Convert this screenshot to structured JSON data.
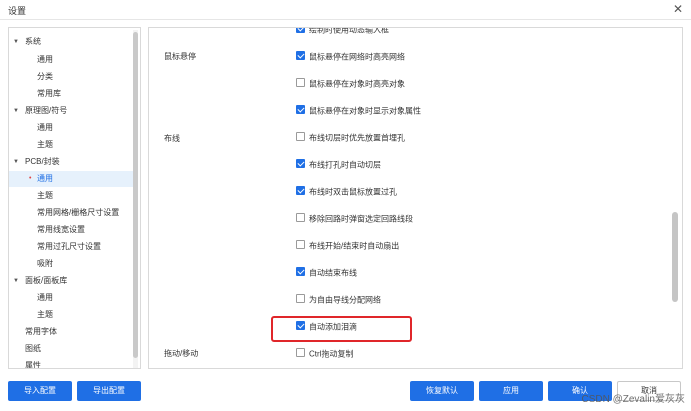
{
  "window": {
    "title": "设置",
    "close_glyph": "✕"
  },
  "tree": [
    {
      "label": "系统",
      "expanded": true,
      "level": 0
    },
    {
      "label": "通用",
      "level": 1
    },
    {
      "label": "分类",
      "level": 1
    },
    {
      "label": "常用库",
      "level": 1
    },
    {
      "label": "原理图/符号",
      "expanded": true,
      "level": 0
    },
    {
      "label": "通用",
      "level": 1
    },
    {
      "label": "主题",
      "level": 1
    },
    {
      "label": "PCB/封装",
      "expanded": true,
      "level": 0
    },
    {
      "label": "通用",
      "level": 1,
      "selected": true
    },
    {
      "label": "主题",
      "level": 1
    },
    {
      "label": "常用网格/栅格尺寸设置",
      "level": 1
    },
    {
      "label": "常用线宽设置",
      "level": 1
    },
    {
      "label": "常用过孔尺寸设置",
      "level": 1
    },
    {
      "label": "吸附",
      "level": 1
    },
    {
      "label": "面板/面板库",
      "expanded": true,
      "level": 0
    },
    {
      "label": "通用",
      "level": 1
    },
    {
      "label": "主题",
      "level": 1
    },
    {
      "label": "常用字体",
      "level": 0
    },
    {
      "label": "图纸",
      "level": 0
    },
    {
      "label": "属性",
      "level": 0
    }
  ],
  "sections": [
    {
      "label": "鼠标悬停"
    },
    {
      "label": "布线"
    },
    {
      "label": "拖动/移动"
    }
  ],
  "options": [
    {
      "label": "绘制时使用动态输入框",
      "checked": true
    },
    {
      "label": "鼠标悬停在网络时高亮网络",
      "checked": true
    },
    {
      "label": "鼠标悬停在对象时高亮对象",
      "checked": false
    },
    {
      "label": "鼠标悬停在对象时显示对象属性",
      "checked": true
    },
    {
      "label": "布线切层时优先放置首埋孔",
      "checked": false
    },
    {
      "label": "布线打孔时自动切层",
      "checked": true
    },
    {
      "label": "布线时双击鼠标放置过孔",
      "checked": true
    },
    {
      "label": "移除回路时弹窗选定回路线段",
      "checked": false
    },
    {
      "label": "布线开始/结束时自动扇出",
      "checked": false
    },
    {
      "label": "自动结束布线",
      "checked": true
    },
    {
      "label": "为自由导线分配网络",
      "checked": false
    },
    {
      "label": "自动添加泪滴",
      "checked": true
    },
    {
      "label": "Ctrl拖动复制",
      "checked": false
    }
  ],
  "buttons": {
    "import": "导入配置",
    "export": "导出配置",
    "restore": "恢复默认",
    "apply": "应用",
    "ok": "确认",
    "cancel": "取消"
  },
  "watermark": "CSDN @Zevalin爱灰灰",
  "colors": {
    "primary": "#1f6fe5",
    "highlight": "#e0262a",
    "selected_bg": "#e6f1fc"
  }
}
